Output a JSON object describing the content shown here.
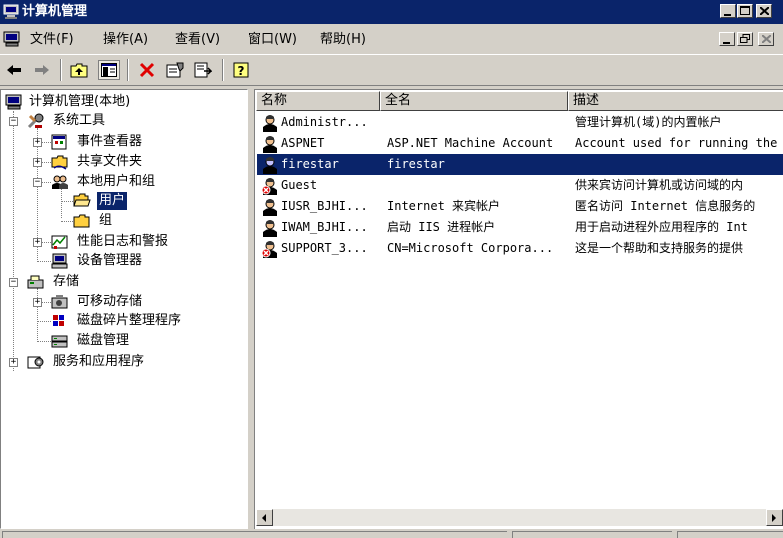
{
  "window": {
    "title": "计算机管理",
    "icon": "computer-management-icon",
    "controls": [
      "minimize",
      "maximize",
      "close"
    ]
  },
  "menu": {
    "items": [
      {
        "label": "文件(F)"
      },
      {
        "label": "操作(A)"
      },
      {
        "label": "查看(V)"
      },
      {
        "label": "窗口(W)"
      },
      {
        "label": "帮助(H)"
      }
    ]
  },
  "toolbar": {
    "buttons": [
      "back-icon",
      "forward-icon",
      "up-folder-icon",
      "show-hide-tree-icon",
      "delete-icon",
      "properties-icon",
      "export-list-icon",
      "help-icon"
    ]
  },
  "tree": {
    "root": "计算机管理(本地)",
    "system_tools": "系统工具",
    "event_viewer": "事件查看器",
    "shared_folders": "共享文件夹",
    "local_users_groups": "本地用户和组",
    "users": "用户",
    "groups": "组",
    "perf_logs": "性能日志和警报",
    "device_manager": "设备管理器",
    "storage": "存储",
    "removable_storage": "可移动存储",
    "disk_defrag": "磁盘碎片整理程序",
    "disk_management": "磁盘管理",
    "services_apps": "服务和应用程序"
  },
  "list": {
    "columns": {
      "name": "名称",
      "full_name": "全名",
      "description": "描述"
    },
    "rows": [
      {
        "name": "Administr...",
        "full_name": "",
        "description": "管理计算机(域)的内置帐户",
        "disabled": false
      },
      {
        "name": "ASPNET",
        "full_name": "ASP.NET Machine Account",
        "description": "Account used for running the",
        "disabled": false
      },
      {
        "name": "firestar",
        "full_name": "firestar",
        "description": "",
        "disabled": false
      },
      {
        "name": "Guest",
        "full_name": "",
        "description": "供来宾访问计算机或访问域的内",
        "disabled": true
      },
      {
        "name": "IUSR_BJHI...",
        "full_name": "Internet 来宾帐户",
        "description": "匿名访问 Internet 信息服务的",
        "disabled": false
      },
      {
        "name": "IWAM_BJHI...",
        "full_name": "启动 IIS 进程帐户",
        "description": "用于启动进程外应用程序的 Int",
        "disabled": false
      },
      {
        "name": "SUPPORT_3...",
        "full_name": "CN=Microsoft Corpora...",
        "description": "这是一个帮助和支持服务的提供",
        "disabled": true
      }
    ],
    "selected_row": 2
  },
  "colors": {
    "titlebar": "#0a246a",
    "selection": "#0a246a",
    "chrome": "#d4d0c8"
  }
}
